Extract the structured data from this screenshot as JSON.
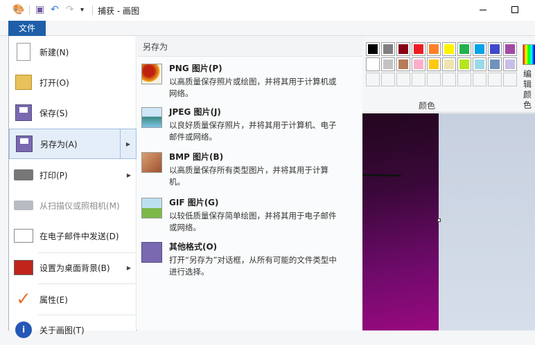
{
  "window": {
    "title": "捕获 - 画图"
  },
  "quick_access": [
    "paint-logo",
    "save",
    "undo",
    "redo",
    "customize"
  ],
  "ribbon": {
    "file_tab": "文件",
    "colors_label": "颜色",
    "edit_colors_label": "编辑颜色",
    "palette_row1": [
      "#000000",
      "#7f7f7f",
      "#880015",
      "#ed1c24",
      "#ff7f27",
      "#fff200",
      "#22b14c",
      "#00a2e8",
      "#3f48cc",
      "#a349a4"
    ],
    "palette_row2": [
      "#ffffff",
      "#c3c3c3",
      "#b97a57",
      "#ffaec9",
      "#ffc90e",
      "#efe4b0",
      "#b5e61d",
      "#99d9ea",
      "#7092be",
      "#c8bfe7"
    ]
  },
  "file_menu": {
    "items": [
      {
        "label": "新建(N)",
        "icon": "new-file-icon"
      },
      {
        "label": "打开(O)",
        "icon": "open-folder-icon"
      },
      {
        "label": "保存(S)",
        "icon": "save-icon"
      },
      {
        "label": "另存为(A)",
        "icon": "save-as-icon",
        "selected": true,
        "submenu": true
      },
      {
        "label": "打印(P)",
        "icon": "printer-icon",
        "submenu": true
      },
      {
        "label": "从扫描仪或照相机(M)",
        "icon": "scanner-icon",
        "disabled": true
      },
      {
        "label": "在电子邮件中发送(D)",
        "icon": "email-icon"
      },
      {
        "label": "设置为桌面背景(B)",
        "icon": "desktop-icon",
        "submenu": true
      },
      {
        "label": "属性(E)",
        "icon": "checkmark-icon"
      },
      {
        "label": "关于画图(T)",
        "icon": "info-icon"
      }
    ],
    "save_as": {
      "header": "另存为",
      "options": [
        {
          "title": "PNG 图片(P)",
          "desc": "以高质量保存照片或绘图，并将其用于计算机或网络。"
        },
        {
          "title": "JPEG 图片(J)",
          "desc": "以良好质量保存照片，并将其用于计算机、电子邮件或网络。"
        },
        {
          "title": "BMP 图片(B)",
          "desc": "以高质量保存所有类型图片，并将其用于计算机。"
        },
        {
          "title": "GIF 图片(G)",
          "desc": "以较低质量保存简单绘图，并将其用于电子邮件或网络。"
        },
        {
          "title": "其他格式(O)",
          "desc": "打开“另存为”对话框，从所有可能的文件类型中进行选择。"
        }
      ]
    }
  }
}
